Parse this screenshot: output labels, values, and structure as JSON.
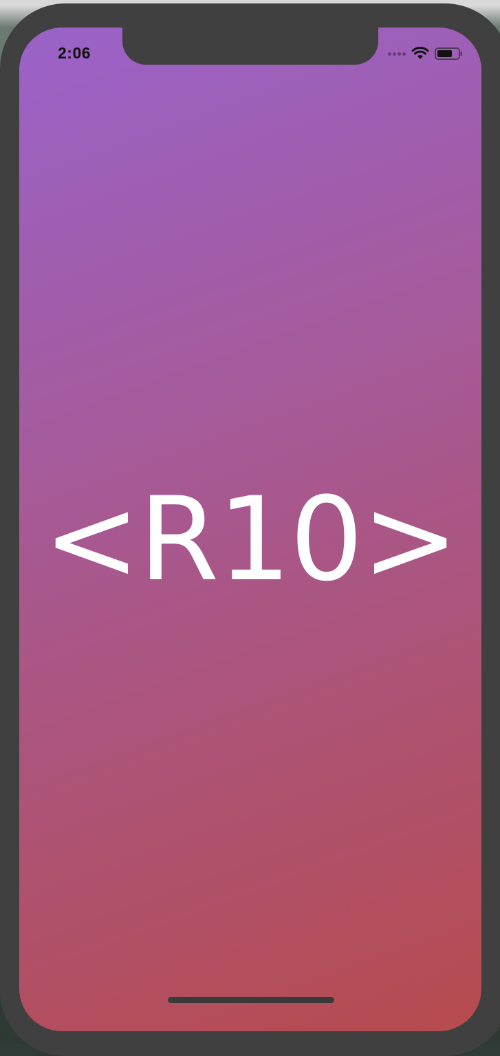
{
  "status_bar": {
    "time": "2:06",
    "icons": [
      "signal-dots-icon",
      "wifi-icon",
      "battery-icon"
    ]
  },
  "splash": {
    "logo_text": "<R10>"
  },
  "colors": {
    "gradient_start": "#9a62c9",
    "gradient_end": "#b64b4e",
    "logo": "#ffffff",
    "frame": "#404040"
  }
}
